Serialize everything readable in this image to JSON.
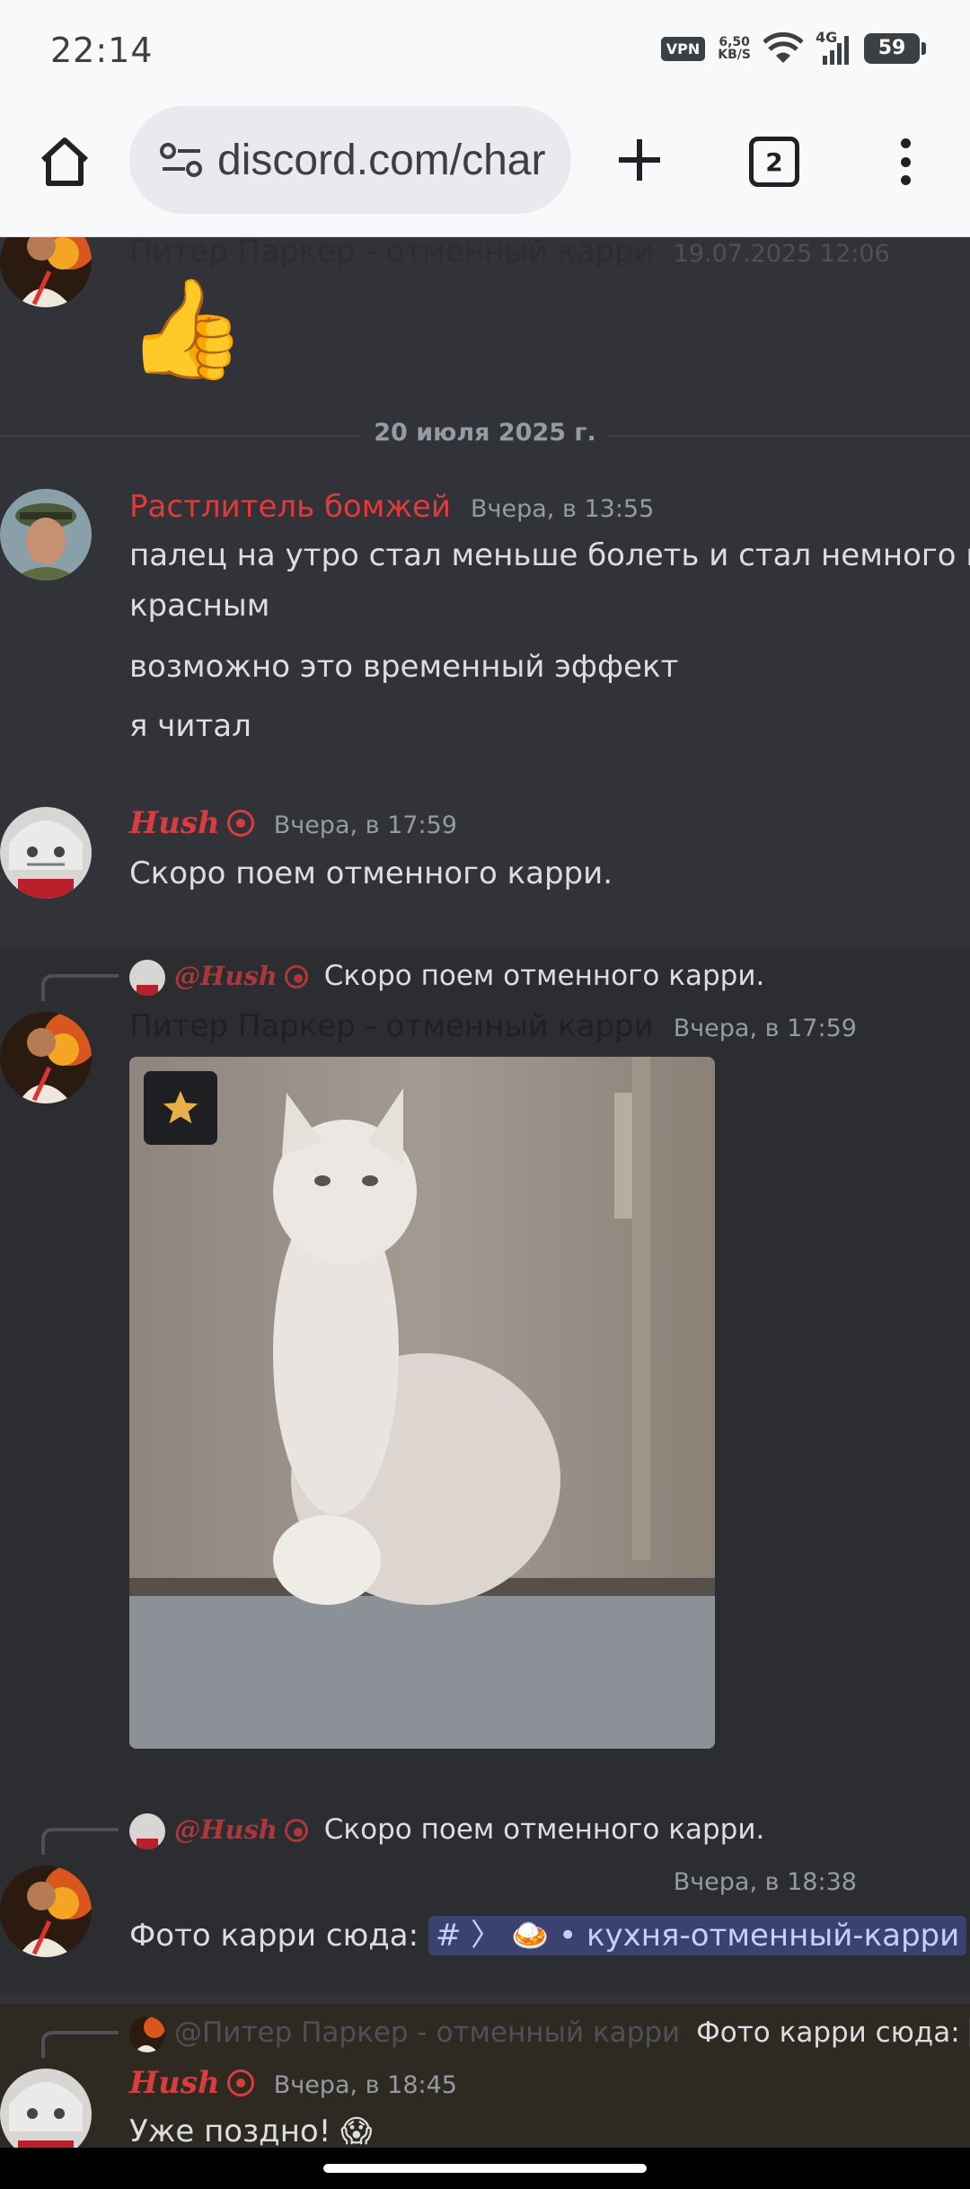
{
  "status_bar": {
    "time": "22:14",
    "vpn": "VPN",
    "net_speed_value": "6,50",
    "net_speed_unit": "KB/S",
    "network": "4G",
    "battery": "59"
  },
  "browser": {
    "url": "discord.com/char",
    "tab_count": "2",
    "icons": [
      "home-icon",
      "site-settings-icon",
      "plus-icon",
      "tabs-icon",
      "more-vert-icon"
    ]
  },
  "chat": {
    "messages": [
      {
        "author": "Питер Паркер - отменный карри",
        "time": "19.07.2025 12:06",
        "emoji": "👍"
      },
      {
        "divider": "20 июля 2025 г."
      },
      {
        "author": "Растлитель бомжей",
        "time": "Вчера, в 13:55",
        "lines": [
          "палец на утро стал меньше болеть и стал немного менее",
          "красным",
          "возможно это временный эффект",
          "я читал"
        ]
      },
      {
        "author": "Hush",
        "time": "Вчера, в 17:59",
        "text": "Скоро поем отменного карри."
      },
      {
        "reply_author": "@Hush",
        "reply_text": "Скоро поем отменного карри.",
        "author": "Питер Паркер - отменный карри",
        "time": "Вчера, в 17:59",
        "attachment": "cat-image"
      },
      {
        "reply_author": "@Hush",
        "reply_text": "Скоро поем отменного карри.",
        "author": "Питер Паркер - отменный карри",
        "time": "Вчера, в 18:38",
        "text": "Фото карри сюда:",
        "channel_hash": "#",
        "channel_arrow": "〉",
        "channel_emoji": "🍛",
        "channel_name": "• кухня-отменный-карри"
      },
      {
        "reply_author": "@Питер Паркер - отменный карри",
        "reply_text": "Фото карри сюда:",
        "reply_channel_hash": "#",
        "author": "Hush",
        "time": "Вчера, в 18:45",
        "text": "Уже поздно!",
        "emoji": "😱"
      }
    ]
  },
  "colors": {
    "chat_bg": "#313338",
    "username_red": "#d83c3e",
    "text": "#dbdee1",
    "muted": "#949ba4",
    "mention_bg": "#3c4270"
  }
}
